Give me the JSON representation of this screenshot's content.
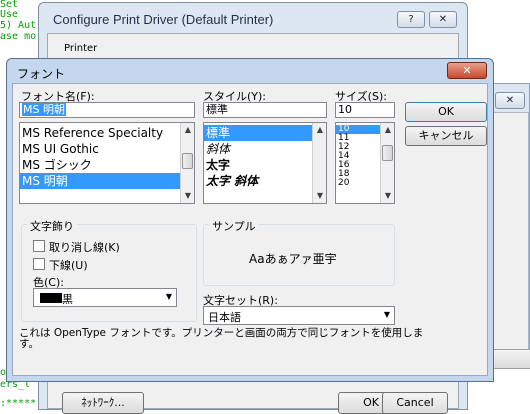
{
  "console": {
    "lines": [
      "Set",
      "  Use",
      "5) Aut",
      "ase mo",
      "",
      "",
      "",
      " othe",
      "ers_l",
      ":*****"
    ]
  },
  "print_driver": {
    "title": "Configure Print Driver  (Default Printer)",
    "help_btn": "?",
    "close_btn": "✕",
    "printer_label": "Printer",
    "network_button": "ﾈｯﾄﾜｰｸ...",
    "ok_button": "OK",
    "cancel_button": "Cancel"
  },
  "third_window": {
    "close_btn": "✕"
  },
  "font_dialog": {
    "title": "フォント",
    "close_btn": "✕",
    "font_name_label": "フォント名(F):",
    "font_name_value": "MS 明朝",
    "font_list": [
      "MS Reference Specialty",
      "MS UI Gothic",
      "MS  ゴシック",
      "MS  明朝"
    ],
    "style_label": "スタイル(Y):",
    "style_value": "標準",
    "style_list": [
      "標準",
      "斜体",
      "太字",
      "太字 斜体"
    ],
    "size_label": "サイズ(S):",
    "size_value": "10",
    "size_list": [
      "10",
      "11",
      "12",
      "14",
      "16",
      "18",
      "20"
    ],
    "ok_button": "OK",
    "cancel_button": "キャンセル",
    "effects_label": "文字飾り",
    "strikeout_label": "取り消し線(K)",
    "underline_label": "下線(U)",
    "color_label": "色(C):",
    "color_value": "黒",
    "sample_label": "サンプル",
    "sample_text": "Aaあぁアァ亜宇",
    "charset_label": "文字セット(R):",
    "charset_value": "日本語",
    "info_text": "これは OpenType フォントです。プリンターと画面の両方で同じフォントを使用しま\nす。"
  },
  "colors": {
    "selection": "#3399ff",
    "console_text": "#00a000"
  }
}
